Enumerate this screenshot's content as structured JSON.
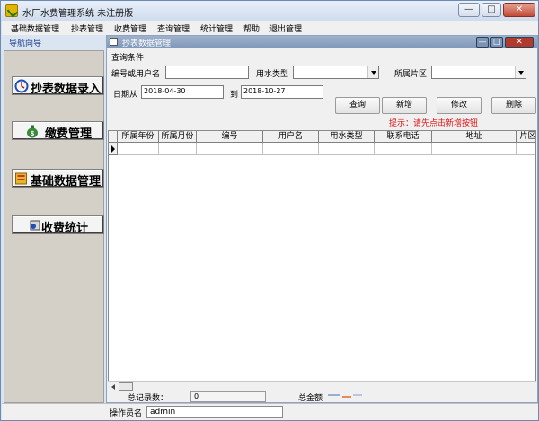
{
  "window": {
    "title": "水厂水费管理系统 未注册版",
    "minimize_label": "—",
    "maximize_label": "□",
    "close_label": "✕"
  },
  "menu": {
    "items": [
      "基础数据管理",
      "抄表管理",
      "收费管理",
      "查询管理",
      "统计管理",
      "帮助",
      "退出管理"
    ]
  },
  "nav": {
    "header": "导航向导",
    "buttons": [
      {
        "label": "抄表数据录入",
        "icon": "meter-reading-icon"
      },
      {
        "label": "缴费管理",
        "icon": "money-bag-icon"
      },
      {
        "label": "基础数据管理",
        "icon": "database-icon"
      },
      {
        "label": "收费统计",
        "icon": "statistics-icon"
      }
    ]
  },
  "form": {
    "title": "抄表数据管理",
    "group_label": "查询条件",
    "fields": {
      "user_label": "编号或用户名",
      "user_value": "",
      "water_type_label": "用水类型",
      "water_type_value": "",
      "area_label": "所属片区",
      "area_value": "",
      "date_from_label": "日期从",
      "date_from_value": "2018-04-30",
      "date_to_label": "到",
      "date_to_value": "2018-10-27"
    },
    "buttons": {
      "query": "查询",
      "add": "新增",
      "edit": "修改",
      "delete": "删除"
    },
    "hint": "提示：请先点击新增按钮",
    "grid": {
      "columns": [
        "所属年份",
        "所属月份",
        "编号",
        "用户名",
        "用水类型",
        "联系电话",
        "地址",
        "片区"
      ],
      "rows": []
    },
    "footer": {
      "record_count_label": "总记录数：",
      "record_count_value": "0",
      "total_amount_label": "总金额"
    }
  },
  "status": {
    "operator_label": "操作员名",
    "operator_value": "admin"
  },
  "colors": {
    "hint": "#e01010",
    "nav_header_text": "#1c3d8c",
    "form_titlebar": "#8ea4c2"
  }
}
